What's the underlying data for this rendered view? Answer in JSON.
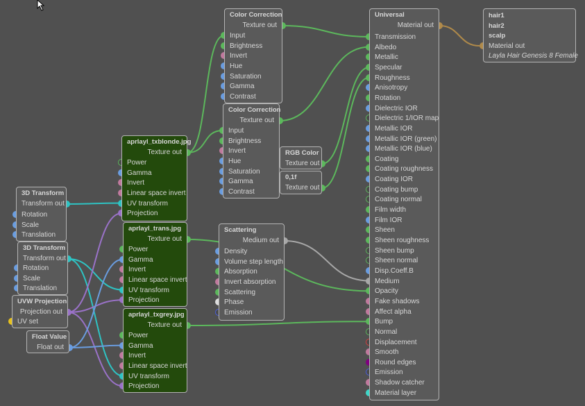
{
  "pin_colors": {
    "tex": "#5cb85c",
    "flt": "#6a9de0",
    "bool": "#c07a9e",
    "xf": "#2ec4c4",
    "proj": "#9a72c8",
    "med": "#a8a8a8",
    "phase": "#dddddd",
    "uv": "#e8c21c",
    "mat": "#b08a4a",
    "disp": "#d94040",
    "round": "#800080",
    "emis": "#4a5ee0",
    "layer": "#3fd6c8"
  },
  "nodes": {
    "cc1": {
      "title": "Color Correction",
      "output": "Texture out",
      "out_pin": "tex",
      "inputs": [
        [
          "Input",
          "tex"
        ],
        [
          "Brightness",
          "tex"
        ],
        [
          "Invert",
          "bool"
        ],
        [
          "Hue",
          "flt"
        ],
        [
          "Saturation",
          "flt"
        ],
        [
          "Gamma",
          "flt"
        ],
        [
          "Contrast",
          "flt"
        ]
      ]
    },
    "cc2": {
      "title": "Color Correction",
      "output": "Texture out",
      "out_pin": "tex",
      "inputs": [
        [
          "Input",
          "tex"
        ],
        [
          "Brightness",
          "tex"
        ],
        [
          "Invert",
          "bool"
        ],
        [
          "Hue",
          "flt"
        ],
        [
          "Saturation",
          "flt"
        ],
        [
          "Gamma",
          "flt"
        ],
        [
          "Contrast",
          "flt"
        ]
      ]
    },
    "rgb": {
      "title": "RGB Color",
      "output": "Texture out",
      "out_pin": "tex",
      "inputs": []
    },
    "f01": {
      "title": "0,1f",
      "output": "Texture out",
      "out_pin": "tex",
      "inputs": []
    },
    "tex1": {
      "title": "aprlayl_txblonde.jpg",
      "output": "Texture out",
      "out_pin": "tex",
      "inputs": [
        [
          "Power",
          "tex-h"
        ],
        [
          "Gamma",
          "flt"
        ],
        [
          "Invert",
          "bool"
        ],
        [
          "Linear space invert",
          "bool"
        ],
        [
          "UV transform",
          "xf"
        ],
        [
          "Projection",
          "proj"
        ]
      ]
    },
    "tex2": {
      "title": "aprlayl_trans.jpg",
      "output": "Texture out",
      "out_pin": "tex",
      "inputs": [
        [
          "Power",
          "tex"
        ],
        [
          "Gamma",
          "flt"
        ],
        [
          "Invert",
          "bool"
        ],
        [
          "Linear space invert",
          "bool"
        ],
        [
          "UV transform",
          "xf"
        ],
        [
          "Projection",
          "proj"
        ]
      ]
    },
    "tex3": {
      "title": "aprlayl_txgrey.jpg",
      "output": "Texture out",
      "out_pin": "tex",
      "inputs": [
        [
          "Power",
          "tex"
        ],
        [
          "Gamma",
          "flt"
        ],
        [
          "Invert",
          "bool"
        ],
        [
          "Linear space invert",
          "bool"
        ],
        [
          "UV transform",
          "xf"
        ],
        [
          "Projection",
          "proj"
        ]
      ]
    },
    "scat": {
      "title": "Scattering",
      "output": "Medium out",
      "out_pin": "med",
      "inputs": [
        [
          "Density",
          "flt"
        ],
        [
          "Volume step length",
          "flt"
        ],
        [
          "Absorption",
          "tex"
        ],
        [
          "Invert absorption",
          "bool"
        ],
        [
          "Scattering",
          "tex"
        ],
        [
          "Phase",
          "phase"
        ],
        [
          "Emission",
          "emis-h"
        ]
      ]
    },
    "t3d1": {
      "title": "3D Transform",
      "output": "Transform out",
      "out_pin": "xf",
      "inputs": [
        [
          "Rotation",
          "flt"
        ],
        [
          "Scale",
          "flt"
        ],
        [
          "Translation",
          "flt"
        ]
      ]
    },
    "t3d2": {
      "title": "3D Transform",
      "output": "Transform out",
      "out_pin": "xf",
      "inputs": [
        [
          "Rotation",
          "flt"
        ],
        [
          "Scale",
          "flt"
        ],
        [
          "Translation",
          "flt"
        ]
      ]
    },
    "uvw": {
      "title": "UVW Projection",
      "output": "Projection out",
      "out_pin": "proj",
      "inputs": [
        [
          "UV set",
          "uv"
        ]
      ]
    },
    "fval": {
      "title": "Float Value",
      "output": "Float out",
      "out_pin": "flt",
      "inputs": []
    },
    "univ": {
      "title": "Universal",
      "output": "Material out",
      "out_pin": "mat",
      "inputs": [
        [
          "Transmission",
          "tex"
        ],
        [
          "Albedo",
          "tex"
        ],
        [
          "Metallic",
          "tex"
        ],
        [
          "Specular",
          "tex"
        ],
        [
          "Roughness",
          "tex"
        ],
        [
          "Anisotropy",
          "flt"
        ],
        [
          "Rotation",
          "tex"
        ],
        [
          "Dielectric IOR",
          "flt"
        ],
        [
          "Dielectric 1/IOR map",
          "tex-h"
        ],
        [
          "Metallic IOR",
          "flt"
        ],
        [
          "Metallic IOR (green)",
          "flt"
        ],
        [
          "Metallic IOR (blue)",
          "flt"
        ],
        [
          "Coating",
          "tex"
        ],
        [
          "Coating roughness",
          "tex"
        ],
        [
          "Coating IOR",
          "flt"
        ],
        [
          "Coating bump",
          "tex-h"
        ],
        [
          "Coating normal",
          "tex-h"
        ],
        [
          "Film width",
          "tex"
        ],
        [
          "Film IOR",
          "flt"
        ],
        [
          "Sheen",
          "tex"
        ],
        [
          "Sheen roughness",
          "tex"
        ],
        [
          "Sheen bump",
          "tex-h"
        ],
        [
          "Sheen normal",
          "tex-h"
        ],
        [
          "Disp.Coeff.B",
          "flt"
        ],
        [
          "Medium",
          "med"
        ],
        [
          "Opacity",
          "tex"
        ],
        [
          "Fake shadows",
          "bool"
        ],
        [
          "Affect alpha",
          "bool"
        ],
        [
          "Bump",
          "tex"
        ],
        [
          "Normal",
          "tex-h"
        ],
        [
          "Displacement",
          "disp-h"
        ],
        [
          "Smooth",
          "bool"
        ],
        [
          "Round edges",
          "round"
        ],
        [
          "Emission",
          "emis-h"
        ],
        [
          "Shadow catcher",
          "bool"
        ],
        [
          "Material layer",
          "layer"
        ]
      ]
    }
  },
  "output_node": {
    "lines": [
      "hair1",
      "hair2",
      "scalp"
    ],
    "input": "Material out",
    "name": "Layla Hair Genesis 8 Female"
  }
}
